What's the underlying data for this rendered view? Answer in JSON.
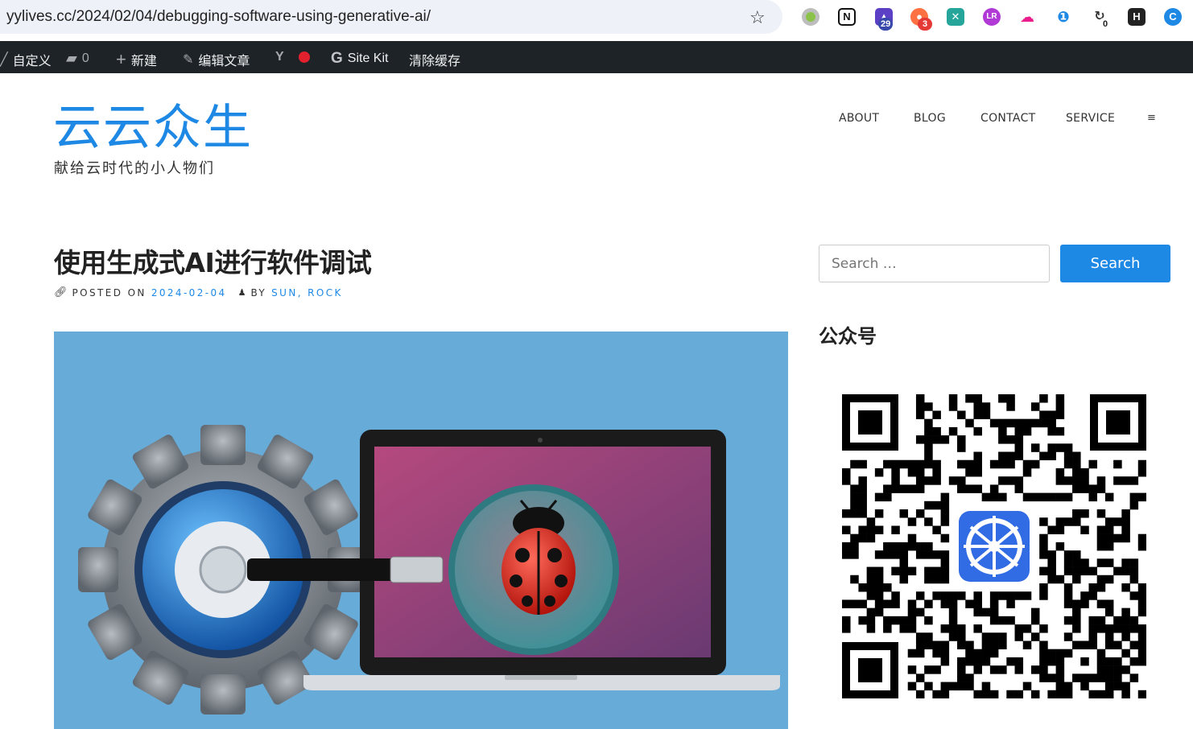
{
  "browser": {
    "url": "yylives.cc/2024/02/04/debugging-software-using-generative-ai/",
    "extensions": [
      {
        "name": "circle-ext-icon",
        "color": "#9e9e9e"
      },
      {
        "name": "notion-icon",
        "color": "#111111"
      },
      {
        "name": "graduation-ext-icon",
        "color": "#5b3fc4",
        "badge": "29",
        "badge_color": "#3949ab"
      },
      {
        "name": "chat-ext-icon",
        "color": "#ff5722",
        "badge": "3",
        "badge_color": "#e53935"
      },
      {
        "name": "grid-ext-icon",
        "color": "#26a69a"
      },
      {
        "name": "lr-ext-icon",
        "color": "#b139d6"
      },
      {
        "name": "cloud-ext-icon",
        "color": "#e91e8c"
      },
      {
        "name": "bookmark-ext-icon",
        "color": "#1e88e5"
      },
      {
        "name": "refresh-ext-icon",
        "color": "#333333",
        "badge": "0",
        "badge_color": "#ffffff"
      },
      {
        "name": "h-ext-icon",
        "color": "#222222"
      },
      {
        "name": "blue-ext-icon",
        "color": "#1e88e5"
      }
    ]
  },
  "adminbar": {
    "customize": "自定义",
    "comments_count": "0",
    "new": "新建",
    "edit": "编辑文章",
    "sitekit": "Site Kit",
    "clear_cache": "清除缓存"
  },
  "site": {
    "title": "云云众生",
    "tagline": "献给云时代的小人物们"
  },
  "nav": {
    "about": "ABOUT",
    "blog": "BLOG",
    "contact": "CONTACT",
    "service": "SERVICE",
    "menu": "≡"
  },
  "post": {
    "title": "使用生成式AI进行软件调试",
    "posted_on": "POSTED ON",
    "date": "2024-02-04",
    "by": "BY",
    "author": "SUN, ROCK"
  },
  "sidebar": {
    "search_placeholder": "Search …",
    "search_button": "Search",
    "widget_title": "公众号"
  },
  "colors": {
    "accent": "#1e88e5",
    "adminbar": "#1d2327",
    "hero_bg": "#67abd9"
  }
}
